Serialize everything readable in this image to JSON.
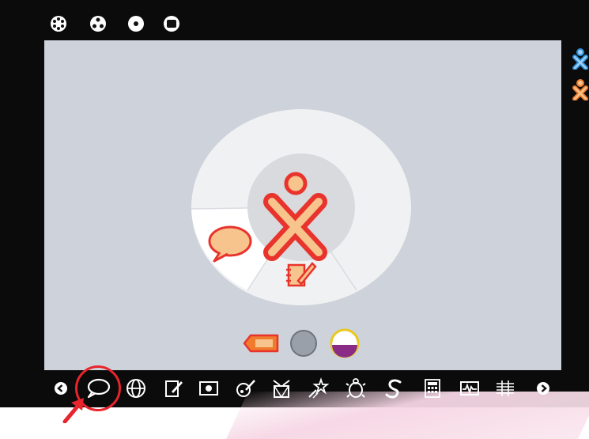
{
  "zoom_bar": {
    "items": [
      {
        "name": "neighborhood-view-icon"
      },
      {
        "name": "group-view-icon"
      },
      {
        "name": "home-view-icon"
      },
      {
        "name": "activity-view-icon"
      }
    ]
  },
  "home_ring": {
    "center_icon": "xo-buddy-icon",
    "segments": [
      {
        "icon": "chat-bubble-icon",
        "state": "active"
      },
      {
        "icon": "write-activity-icon",
        "state": "inactive"
      }
    ]
  },
  "buddies": [
    {
      "name": "buddy-blue-icon",
      "color": "#2a8fd8"
    },
    {
      "name": "buddy-orange-icon",
      "color": "#f07b2c"
    }
  ],
  "status": {
    "items": [
      {
        "name": "tag-battery-icon"
      },
      {
        "name": "network-icon"
      },
      {
        "name": "battery-level-icon"
      }
    ]
  },
  "activities": {
    "items": [
      {
        "name": "chat-activity-icon"
      },
      {
        "name": "browse-activity-icon"
      },
      {
        "name": "write-activity-icon"
      },
      {
        "name": "record-activity-icon"
      },
      {
        "name": "paint-activity-icon"
      },
      {
        "name": "tamtam-activity-icon"
      },
      {
        "name": "star-activity-icon"
      },
      {
        "name": "turtle-activity-icon"
      },
      {
        "name": "snake-activity-icon"
      },
      {
        "name": "calculate-activity-icon"
      },
      {
        "name": "measure-activity-icon"
      },
      {
        "name": "music-activity-icon"
      }
    ],
    "selected": "chat-activity-icon"
  },
  "colors": {
    "frame": "#0b0b0b",
    "canvas": "#ced2da",
    "xo_stroke": "#e8342c",
    "xo_fill": "#f6c48c",
    "highlight": "#e8242c"
  }
}
